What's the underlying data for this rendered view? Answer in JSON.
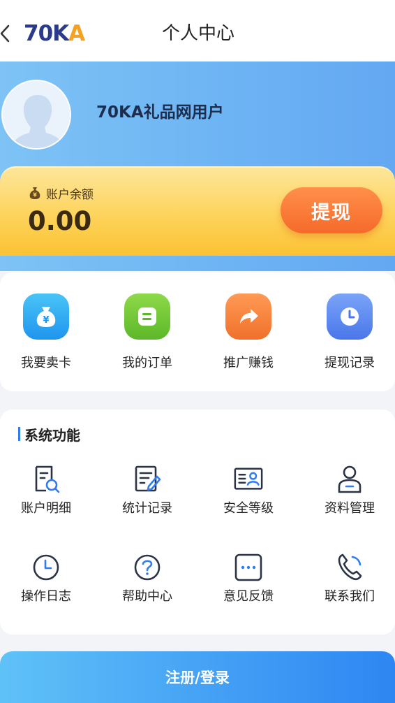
{
  "header": {
    "logo_part1": "70",
    "logo_part2": "K",
    "logo_part3": "A",
    "title": "个人中心"
  },
  "profile": {
    "username": "70KA礼品网用户"
  },
  "balance": {
    "label": "账户余额",
    "value": "0.00",
    "withdraw_label": "提现"
  },
  "quick_actions": [
    {
      "label": "我要卖卡",
      "icon": "money-bag-icon",
      "color": "#2fa6f1"
    },
    {
      "label": "我的订单",
      "icon": "order-list-icon",
      "color": "#6cc431"
    },
    {
      "label": "推广赚钱",
      "icon": "share-arrow-icon",
      "color": "#f57c2c"
    },
    {
      "label": "提现记录",
      "icon": "clock-icon",
      "color": "#4f7ef0"
    }
  ],
  "system": {
    "title": "系统功能",
    "items": [
      {
        "label": "账户明细",
        "icon": "account-detail-icon"
      },
      {
        "label": "统计记录",
        "icon": "statistics-edit-icon"
      },
      {
        "label": "安全等级",
        "icon": "id-card-icon"
      },
      {
        "label": "资料管理",
        "icon": "user-profile-icon"
      },
      {
        "label": "操作日志",
        "icon": "clock-icon"
      },
      {
        "label": "帮助中心",
        "icon": "question-icon"
      },
      {
        "label": "意见反馈",
        "icon": "feedback-dots-icon"
      },
      {
        "label": "联系我们",
        "icon": "phone-icon"
      }
    ]
  },
  "login": {
    "label": "注册/登录"
  },
  "colors": {
    "hero_blue": "#6fb6f4",
    "balance_yellow": "#fdd35b",
    "withdraw_orange": "#f66a2a",
    "accent_blue": "#2f7cf0",
    "icon_dark": "#2b3447"
  }
}
